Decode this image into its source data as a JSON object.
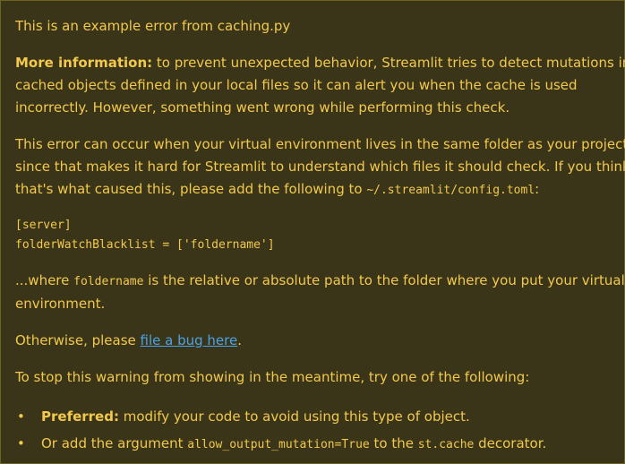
{
  "alert": {
    "header": "This is an example error from caching.py",
    "more_info_label": "More information:",
    "more_info_text": " to prevent unexpected behavior, Streamlit tries to detect mutations in",
    "more_info_line2": "cached objects defined in your local files so it can alert you when the cache is used",
    "more_info_line3": "incorrectly. However, something went wrong while performing this check.",
    "venv_line1": "This error can occur when your virtual environment lives in the same folder as your project,",
    "venv_line2": "since that makes it hard for Streamlit to understand which files it should check. If you think",
    "venv_line3_pre": "that's what caused this, please add the following to ",
    "venv_config_path": "~/.streamlit/config.toml",
    "venv_line3_post": ":",
    "code_line1": "[server]",
    "code_line2": "folderWatchBlacklist = ['foldername']",
    "where_pre": "...where ",
    "where_code": "foldername",
    "where_post": " is the relative or absolute path to the folder where you put your virtual",
    "where_line2": "environment.",
    "otherwise_pre": "Otherwise, please ",
    "bug_link": "file a bug here",
    "otherwise_post": ".",
    "stop_text": "To stop this warning from showing in the meantime, try one of the following:",
    "bullet": "•",
    "option1_label": "Preferred:",
    "option1_text": " modify your code to avoid using this type of object.",
    "option2_pre": "Or add the argument ",
    "option2_code": "allow_output_mutation=True",
    "option2_mid": " to the ",
    "option2_code2": "st.cache",
    "option2_post": " decorator."
  },
  "colors": {
    "background": "#3a3518",
    "text": "#f2c94c",
    "link": "#4aa3e8",
    "border": "#6e6421"
  }
}
